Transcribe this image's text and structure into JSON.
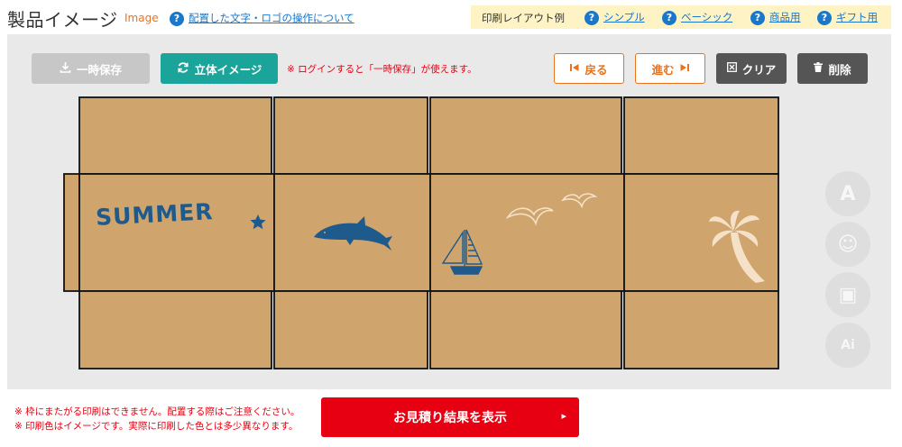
{
  "header": {
    "title": "製品イメージ",
    "subtitle": "Image",
    "help_icon": "?",
    "help_link": "配置した文字・ロゴの操作について"
  },
  "layout_examples": {
    "label": "印刷レイアウト例",
    "links": [
      "シンプル",
      "ベーシック",
      "商品用",
      "ギフト用"
    ]
  },
  "toolbar": {
    "save_label": "一時保存",
    "view3d_label": "立体イメージ",
    "login_note": "※ ログインすると「一時保存」が使えます。",
    "back_label": "戻る",
    "forward_label": "進む",
    "clear_label": "クリア",
    "delete_label": "削除"
  },
  "canvas": {
    "summer_text": "SUMMER",
    "box_color": "#cfa46d",
    "line_color": "#111111",
    "navy": "#1e5a8c",
    "cream": "#f5e1c8"
  },
  "side_tools": [
    {
      "name": "text-tool",
      "glyph": "A"
    },
    {
      "name": "stamp-tool",
      "glyph": "☺"
    },
    {
      "name": "image-tool",
      "glyph": "▣"
    },
    {
      "name": "ai-tool",
      "glyph": "Ai"
    }
  ],
  "footer": {
    "warning_1": "※ 枠にまたがる印刷はできません。配置する際はご注意ください。",
    "warning_2": "※ 印刷色はイメージです。実際に印刷した色とは多少異なります。",
    "estimate_label": "お見積り結果を表示",
    "estimate_arrow": "▸"
  },
  "colors": {
    "accent_orange": "#e8731d",
    "teal": "#1ba49a",
    "red": "#e60012",
    "link_blue": "#1a77c9"
  }
}
